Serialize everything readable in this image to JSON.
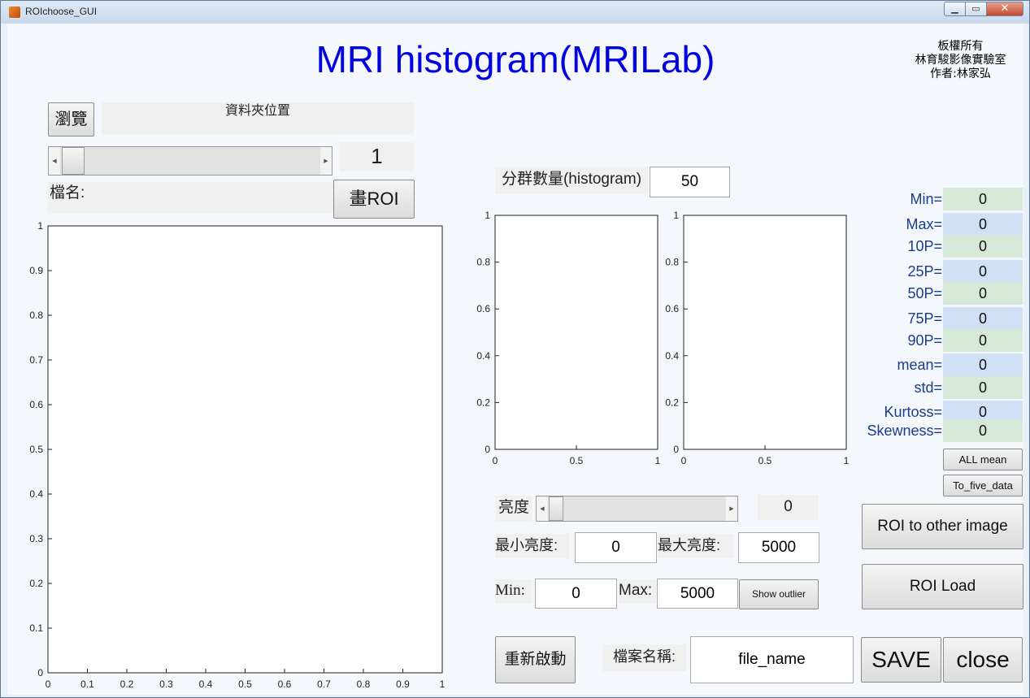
{
  "window": {
    "title": "ROIchoose_GUI"
  },
  "header": {
    "title": "MRI histogram(MRILab)",
    "copyright": [
      "板權所有",
      "林育駿影像實驗室",
      "作者:林家弘"
    ]
  },
  "folder": {
    "browse_label": "瀏覽",
    "path_label": "資料夾位置"
  },
  "slice": {
    "index": "1"
  },
  "file": {
    "name_label": "檔名:"
  },
  "roi": {
    "draw_label": "畫ROI"
  },
  "histogram": {
    "bins_label": "分群數量(histogram)",
    "bins_value": "50"
  },
  "brightness": {
    "label": "亮度",
    "value": "0",
    "min_label": "最小亮度:",
    "min_value": "0",
    "max_label": "最大亮度:",
    "max_value": "5000"
  },
  "range": {
    "min_label": "Min:",
    "min_value": "0",
    "max_label": "Max:",
    "max_value": "5000",
    "outlier_button": "Show outlier"
  },
  "stats": [
    {
      "label": "Min=",
      "value": "0"
    },
    {
      "label": "Max=",
      "value": "0"
    },
    {
      "label": "10P=",
      "value": "0"
    },
    {
      "label": "25P=",
      "value": "0"
    },
    {
      "label": "50P=",
      "value": "0"
    },
    {
      "label": "75P=",
      "value": "0"
    },
    {
      "label": "90P=",
      "value": "0"
    },
    {
      "label": "mean=",
      "value": "0"
    },
    {
      "label": "std=",
      "value": "0"
    },
    {
      "label": "Kurtoss=",
      "value": "0"
    },
    {
      "label": "Skewness=",
      "value": "0"
    }
  ],
  "buttons": {
    "all_mean": "ALL mean",
    "to_five_data": "To_five_data",
    "roi_to_other_image": "ROI to other image",
    "roi_load": "ROI Load",
    "restart": "重新啟動",
    "save": "SAVE",
    "close": "close"
  },
  "save_file": {
    "label": "檔案名稱:",
    "value": "file_name"
  },
  "colors": {
    "title_blue": "#0000e0",
    "stat_label": "#1a3c8c",
    "stat_green": "#d6e9d8",
    "stat_blue": "#d0e0f5"
  },
  "chart_data": [
    {
      "type": "scatter",
      "title": "",
      "x": [],
      "y": [],
      "xlim": [
        0,
        1
      ],
      "ylim": [
        0,
        1
      ],
      "xticks": [
        "0",
        "0.1",
        "0.2",
        "0.3",
        "0.4",
        "0.5",
        "0.6",
        "0.7",
        "0.8",
        "0.9",
        "1"
      ],
      "yticks": [
        "0",
        "0.1",
        "0.2",
        "0.3",
        "0.4",
        "0.5",
        "0.6",
        "0.7",
        "0.8",
        "0.9",
        "1"
      ]
    },
    {
      "type": "bar",
      "title": "",
      "values": [],
      "xlim": [
        0,
        1
      ],
      "ylim": [
        0,
        1
      ],
      "xticks": [
        "0",
        "0.5",
        "1"
      ],
      "yticks": [
        "0",
        "0.2",
        "0.4",
        "0.6",
        "0.8",
        "1"
      ]
    },
    {
      "type": "bar",
      "title": "",
      "values": [],
      "xlim": [
        0,
        1
      ],
      "ylim": [
        0,
        1
      ],
      "xticks": [
        "0",
        "0.5",
        "1"
      ],
      "yticks": [
        "0",
        "0.2",
        "0.4",
        "0.6",
        "0.8",
        "1"
      ]
    }
  ]
}
